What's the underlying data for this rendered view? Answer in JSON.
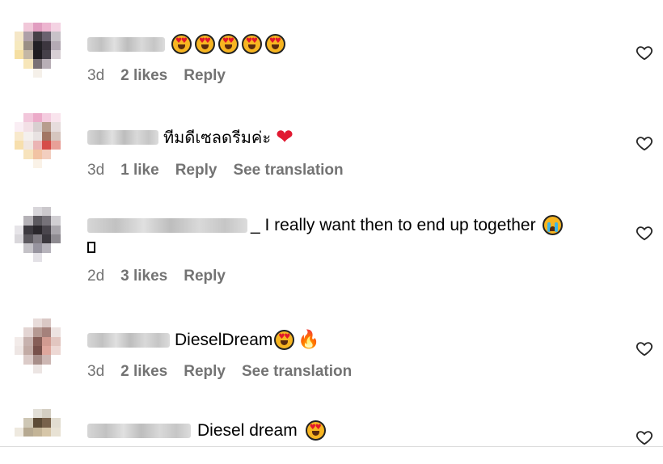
{
  "comments": [
    {
      "text": "",
      "emojis": [
        "heart-eyes",
        "heart-eyes",
        "heart-eyes",
        "heart-eyes",
        "heart-eyes"
      ],
      "time": "3d",
      "likes": "2 likes",
      "reply": "Reply",
      "translation": ""
    },
    {
      "text": "ทีมดีเซลดรีมค่ะ",
      "emojis": [
        "red-heart"
      ],
      "time": "3d",
      "likes": "1 like",
      "reply": "Reply",
      "translation": "See translation"
    },
    {
      "text": "_ I really want then to end up together",
      "emojis": [
        "crying-face"
      ],
      "time": "2d",
      "likes": "3 likes",
      "reply": "Reply",
      "translation": ""
    },
    {
      "text": "DieselDream",
      "emojis": [
        "heart-eyes",
        "fire"
      ],
      "time": "3d",
      "likes": "2 likes",
      "reply": "Reply",
      "translation": "See translation"
    },
    {
      "text": "Diesel dream",
      "emojis": [
        "heart-eyes"
      ],
      "time": "",
      "likes": "",
      "reply": "",
      "translation": ""
    }
  ],
  "colors": {
    "meta_text": "#737373",
    "divider": "#dbdbdb"
  }
}
